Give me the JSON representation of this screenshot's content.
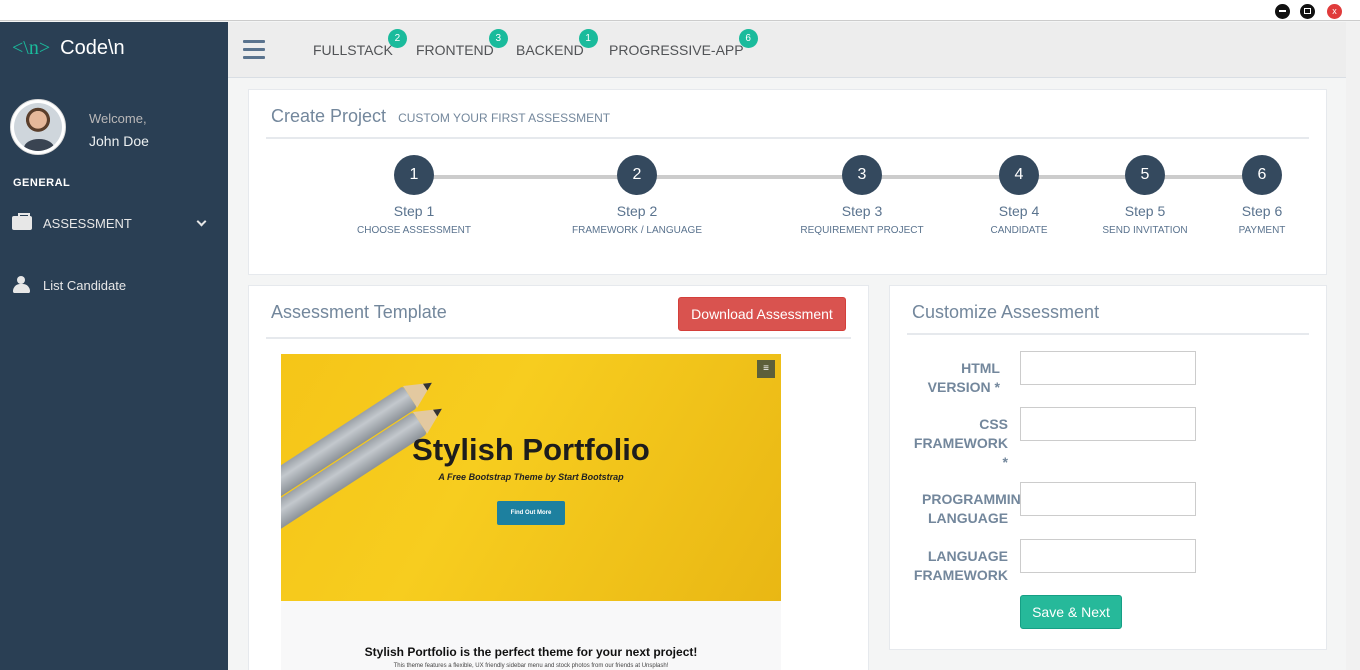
{
  "window": {
    "close_label": "x"
  },
  "brand": {
    "icon": "<\\n>",
    "name": "Code\\n"
  },
  "profile": {
    "welcome": "Welcome,",
    "name": "John Doe"
  },
  "sidebar": {
    "section": "GENERAL",
    "items": [
      {
        "label": "ASSESSMENT",
        "icon": "briefcase-icon"
      },
      {
        "label": "List Candidate",
        "icon": "users-icon"
      }
    ]
  },
  "topnav": {
    "items": [
      {
        "label": "FULLSTACK",
        "badge": "2"
      },
      {
        "label": "FRONTEND",
        "badge": "3"
      },
      {
        "label": "BACKEND",
        "badge": "1"
      },
      {
        "label": "PROGRESSIVE-APP",
        "badge": "6"
      }
    ]
  },
  "create_project": {
    "title": "Create Project",
    "subtitle": "CUSTOM YOUR FIRST ASSESSMENT",
    "steps": [
      {
        "num": "1",
        "title": "Step 1",
        "desc": "CHOOSE ASSESSMENT"
      },
      {
        "num": "2",
        "title": "Step 2",
        "desc": "FRAMEWORK / LANGUAGE"
      },
      {
        "num": "3",
        "title": "Step 3",
        "desc": "REQUIREMENT PROJECT"
      },
      {
        "num": "4",
        "title": "Step 4",
        "desc": "CANDIDATE"
      },
      {
        "num": "5",
        "title": "Step 5",
        "desc": "SEND INVITATION"
      },
      {
        "num": "6",
        "title": "Step 6",
        "desc": "PAYMENT"
      }
    ]
  },
  "template": {
    "title": "Assessment Template",
    "download_label": "Download Assessment",
    "preview": {
      "menu_icon": "≡",
      "hero_title": "Stylish Portfolio",
      "hero_subtitle": "A Free Bootstrap Theme by Start Bootstrap",
      "hero_button": "Find Out More",
      "section_title": "Stylish Portfolio is the perfect theme for your next project!",
      "section_text": "This theme features a flexible, UX friendly sidebar menu and stock photos from our friends at Unsplash!"
    }
  },
  "customize": {
    "title": "Customize Assessment",
    "fields": [
      {
        "label_line1": "HTML",
        "label_line2": "VERSION *",
        "label_line3": "",
        "value": ""
      },
      {
        "label_line1": "CSS",
        "label_line2": "FRAMEWORK",
        "label_line3": "*",
        "value": ""
      },
      {
        "label_line1": "PROGRAMMING",
        "label_line2": "LANGUAGE",
        "label_line3": "",
        "value": ""
      },
      {
        "label_line1": "LANGUAGE",
        "label_line2": "FRAMEWORK",
        "label_line3": "",
        "value": ""
      }
    ],
    "submit_label": "Save & Next"
  }
}
